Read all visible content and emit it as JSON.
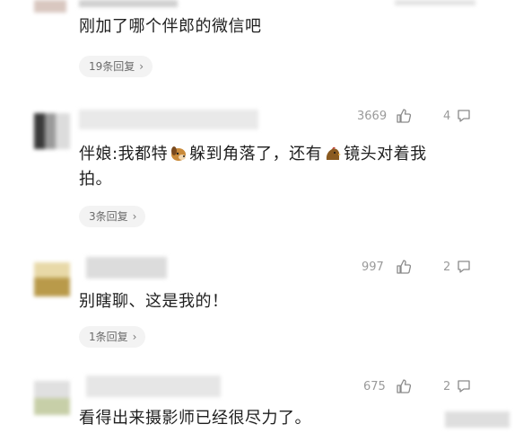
{
  "comments": [
    {
      "text": "刚加了哪个伴郎的微信吧",
      "reply_label": "19条回复",
      "reply_chevron": "›"
    },
    {
      "likes": "3669",
      "replies_count": "4",
      "text_part1": "伴娘:我都特",
      "emoji1": "dog-face-emoji",
      "text_part2": "躲到角落了，还有",
      "emoji2": "chicken-emoji",
      "text_part3": "镜头对着我",
      "text_line2": "拍。",
      "reply_label": "3条回复",
      "reply_chevron": "›"
    },
    {
      "likes": "997",
      "replies_count": "2",
      "text": "别瞎聊、这是我的！",
      "reply_label": "1条回复",
      "reply_chevron": "›"
    },
    {
      "likes": "675",
      "replies_count": "2",
      "text": "看得出来摄影师已经很尽力了。"
    }
  ],
  "icons": {
    "like": "thumbs-up-icon",
    "reply": "comment-bubble-icon"
  }
}
